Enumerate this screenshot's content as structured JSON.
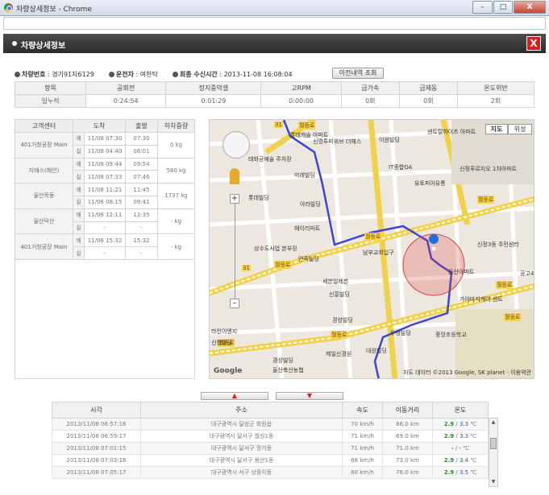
{
  "window": {
    "title": "차량상세정보 - Chrome",
    "minimize": "–",
    "maximize": "□",
    "close": "X"
  },
  "panel": {
    "title": "차량상세정보",
    "close": "X"
  },
  "info": {
    "vehicle_label": "차량번호",
    "vehicle_value": "경기91자6129",
    "driver_label": "운전자",
    "driver_value": "여한탁",
    "received_label": "최종 수신시간",
    "received_value": "2013-11-08 16:08:04",
    "history_button": "이전내역 조회"
  },
  "stats": {
    "headers": [
      "항목",
      "공회전",
      "정지중악셀",
      "고RPM",
      "급가속",
      "급제동",
      "온도위반"
    ],
    "row_label": "일누적",
    "values": [
      "0:24:54",
      "0:01:29",
      "0:00:00",
      "0회",
      "0회",
      "2회"
    ]
  },
  "stops": {
    "headers": [
      "고객센터",
      "도착",
      "출발",
      "하차중량"
    ],
    "plan_label": "예",
    "actual_label": "실",
    "rows": [
      {
        "name": "401거창공장 Main",
        "plan_arrive": "11/08 07:30",
        "plan_depart": "07:30",
        "actual_arrive": "11/08 04:40",
        "actual_depart": "06:01",
        "weight": "0 kg"
      },
      {
        "name": "지에스(해안)",
        "plan_arrive": "11/08 09:44",
        "plan_depart": "09:54",
        "actual_arrive": "11/08 07:33",
        "actual_depart": "07:46",
        "weight": "580 kg"
      },
      {
        "name": "울산목동",
        "plan_arrive": "11/08 11:21",
        "plan_depart": "11:45",
        "actual_arrive": "11/08 08:15",
        "actual_depart": "09:41",
        "weight": "1737 kg"
      },
      {
        "name": "울산덕산",
        "plan_arrive": "11/08 12:11",
        "plan_depart": "12:35",
        "actual_arrive": "-",
        "actual_depart": "-",
        "weight": "- kg"
      },
      {
        "name": "401거창공장 Main",
        "plan_arrive": "11/08 15:32",
        "plan_depart": "15:32",
        "actual_arrive": "-",
        "actual_depart": "-",
        "weight": "- kg"
      }
    ]
  },
  "map": {
    "type_map": "지도",
    "type_satellite": "위성",
    "attribution": "지도 데이터 ©2013 Google, SK planet - 이용약관",
    "google_logo": "Google",
    "labels": [
      "센트럴하이츠 아파트",
      "신명투미위브 더헤스",
      "태화공예술 주차장",
      "이원빌딩",
      "롯데캐슬 아파트",
      "미래빌딩",
      "IT종합OA",
      "유토피아유통",
      "신정푸르지오 1차아파트",
      "롯데빌딩",
      "아라빌딩",
      "헤이리마트",
      "상수도사업 본부장",
      "민족빌딩",
      "세븐일레븐",
      "신흥빌딩",
      "남부교회입구",
      "신정3동 주민센터",
      "울산아파트",
      "가야마지케어 센트",
      "중앙초등학교",
      "우정빌딩",
      "경성빌딩",
      "제일신경원",
      "대원빌딩",
      "경성빌딩",
      "울산축산농협",
      "라인이엔지",
      "신창빌딩",
      "공고4"
    ],
    "roads": [
      "월등로",
      "월등로",
      "월등로",
      "월등로",
      "월등로",
      "월등로",
      "월등로",
      "월등로"
    ],
    "road_numbers": [
      "31",
      "31"
    ]
  },
  "log": {
    "headers": [
      "시각",
      "주소",
      "속도",
      "이동거리",
      "온도"
    ],
    "rows": [
      {
        "time": "2013/11/08 06:57:16",
        "addr": "대구광역시 달성군 화원읍",
        "speed": "70 km/h",
        "dist": "66.0 km",
        "temp_a": "2.9",
        "temp_b": "3.3",
        "temp_unit": "℃"
      },
      {
        "time": "2013/11/08 06:59:17",
        "addr": "대구광역시 달서구 월성1동",
        "speed": "71 km/h",
        "dist": "69.0 km",
        "temp_a": "2.9",
        "temp_b": "3.3",
        "temp_unit": "℃"
      },
      {
        "time": "2013/11/08 07:01:15",
        "addr": "대구광역시 달서구 장기동",
        "speed": "71 km/h",
        "dist": "71.0 km",
        "temp_a": "-",
        "temp_b": "-",
        "temp_unit": "℃"
      },
      {
        "time": "2013/11/08 07:03:16",
        "addr": "대구광역시 달서구 용산1동",
        "speed": "68 km/h",
        "dist": "73.0 km",
        "temp_a": "2.9",
        "temp_b": "3.4",
        "temp_unit": "℃"
      },
      {
        "time": "2013/11/08 07:05:17",
        "addr": "대구광역시 서구 상중이동",
        "speed": "80 km/h",
        "dist": "76.0 km",
        "temp_a": "2.9",
        "temp_b": "3.5",
        "temp_unit": "℃"
      }
    ]
  }
}
